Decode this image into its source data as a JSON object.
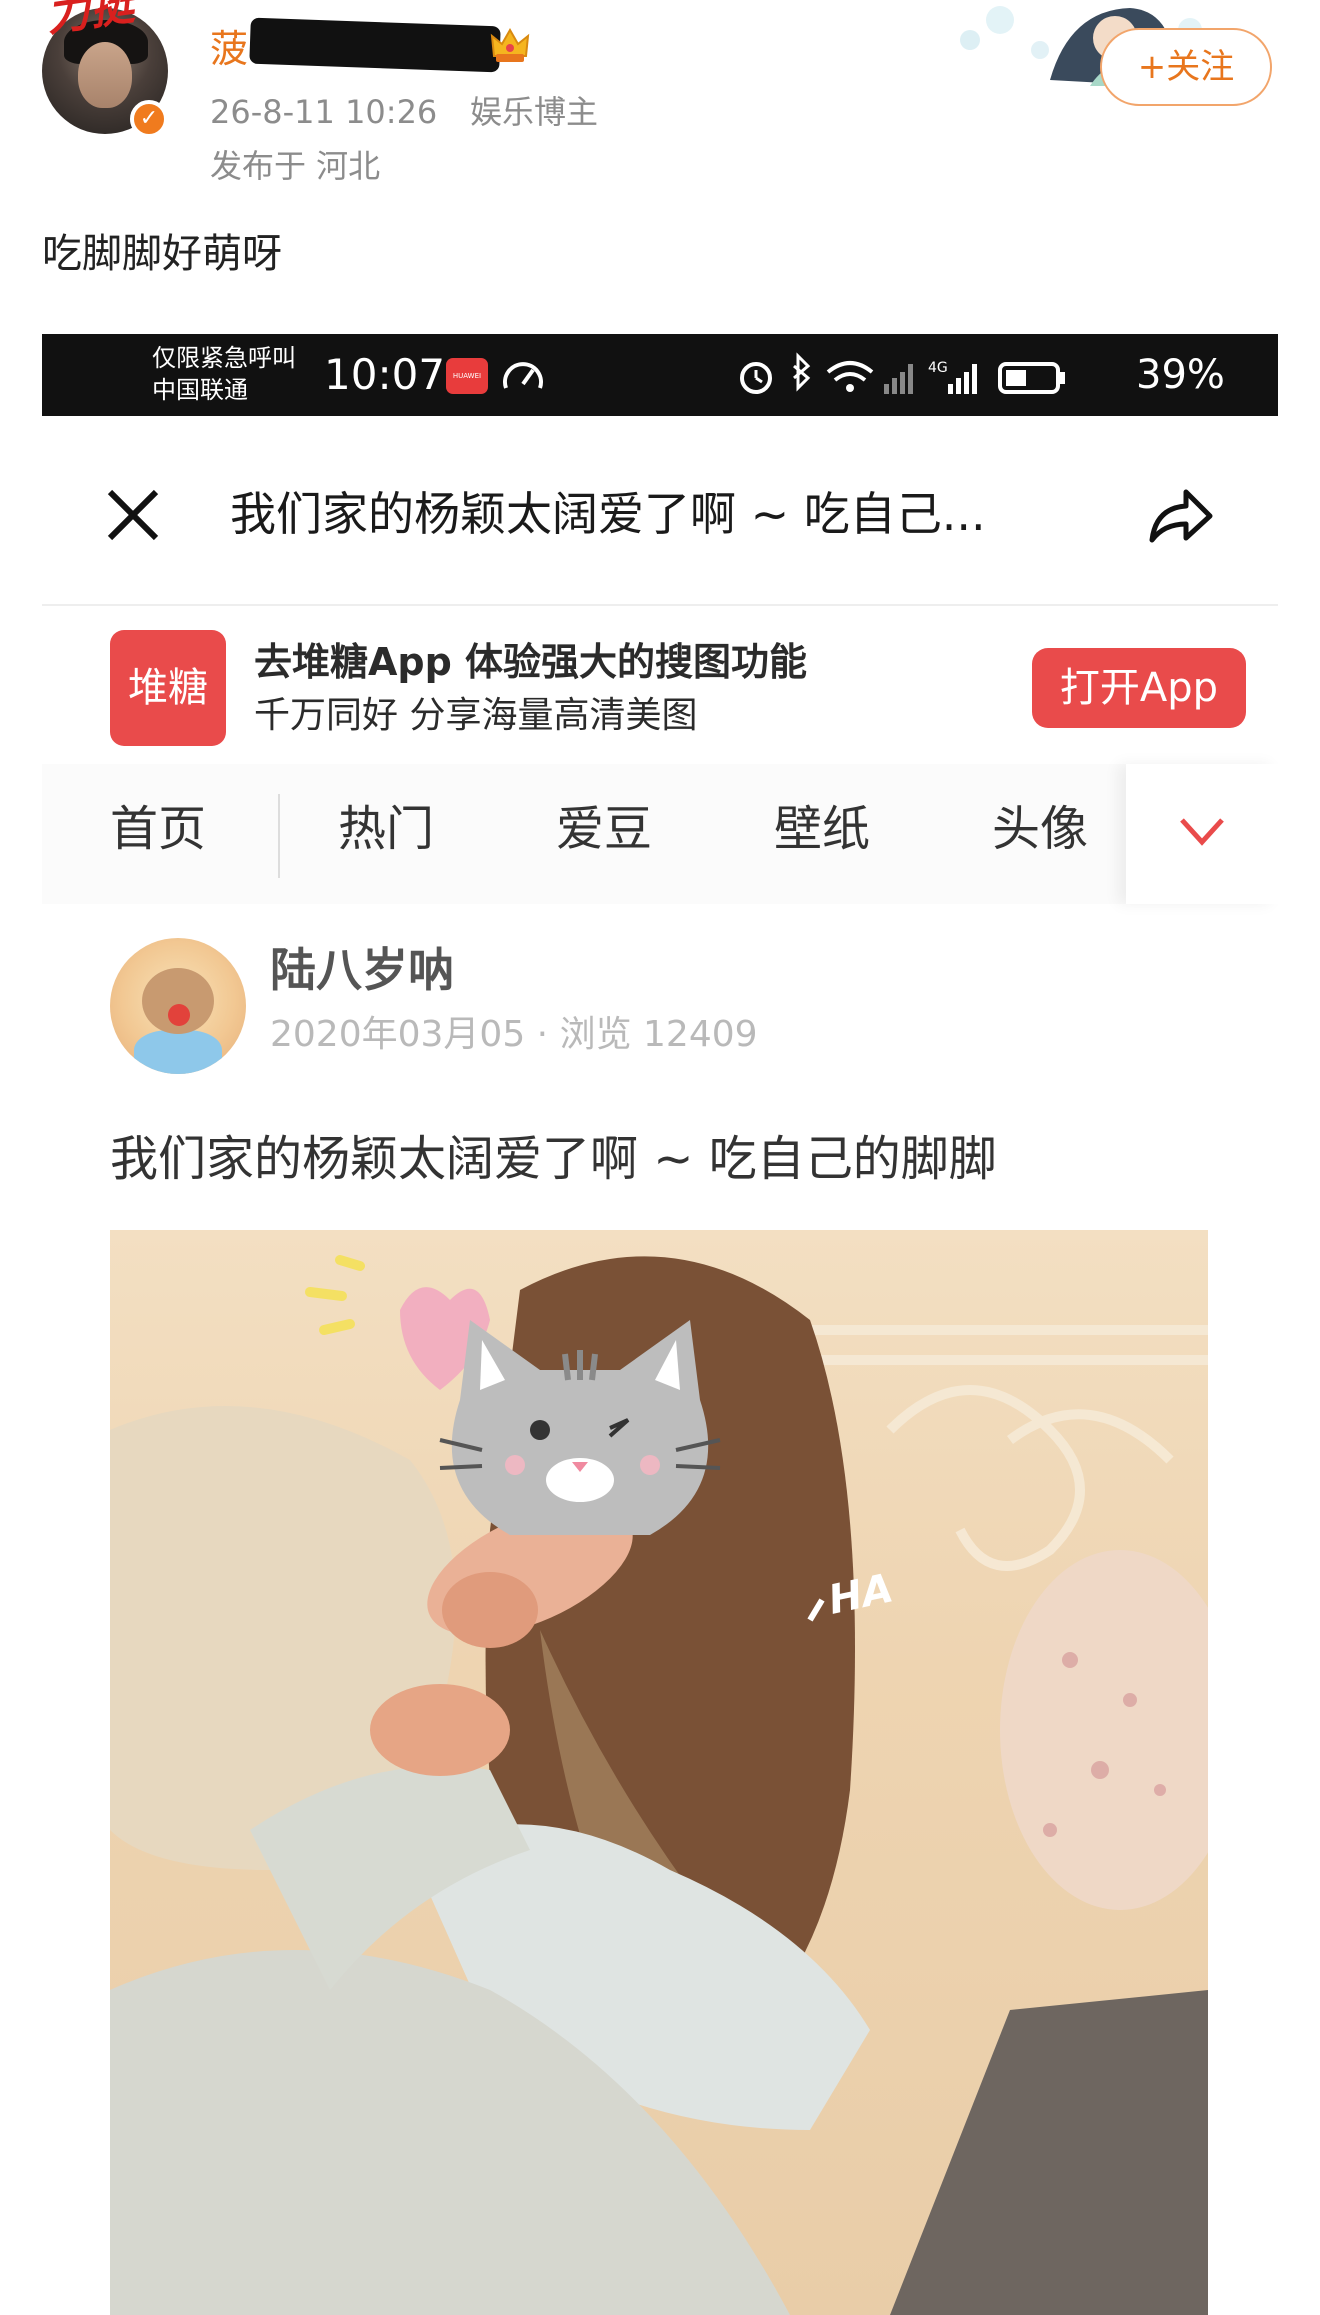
{
  "weibo_post": {
    "deco_text": "力挺",
    "username_visible": "菠",
    "timestamp": "26-8-11 10:26",
    "role": "娱乐博主",
    "location": "发布于 河北",
    "follow_label": "+关注",
    "caption": "吃脚脚好萌呀"
  },
  "embedded_screenshot": {
    "status_bar": {
      "carrier_line1": "仅限紧急呼叫",
      "carrier_line2": "中国联通",
      "time": "10:07",
      "battery": "39%"
    },
    "navbar": {
      "title": "我们家的杨颖太阔爱了啊 ~ 吃自己..."
    },
    "app_banner": {
      "logo_text": "堆糖",
      "title": "去堆糖App 体验强大的搜图功能",
      "subtitle": "千万同好 分享海量高清美图",
      "open_button": "打开App"
    },
    "tabs": [
      "首页",
      "热门",
      "爱豆",
      "壁纸",
      "头像"
    ],
    "post": {
      "author": "陆八岁呐",
      "meta": "2020年03月05 · 浏览 12409",
      "title": "我们家的杨颖太阔爱了啊 ~ 吃自己的脚脚",
      "photo_text": "HA"
    }
  },
  "colors": {
    "weibo_orange": "#e8761d",
    "duitang_red": "#e94b4b",
    "status_bar_bg": "#111111"
  }
}
